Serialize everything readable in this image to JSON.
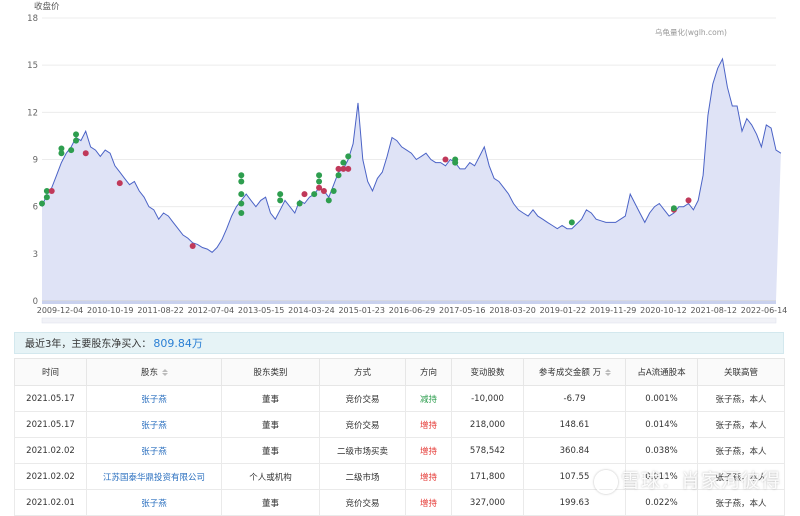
{
  "chart_data": {
    "type": "area",
    "ylabel": "收盘价",
    "watermark": "乌龟量化(wglh.com)",
    "ylim": [
      0,
      18
    ],
    "yticks": [
      0,
      3,
      6,
      9,
      12,
      15,
      18
    ],
    "xtick_labels": [
      "2009-12-04",
      "2010-10-19",
      "2011-08-22",
      "2012-07-04",
      "2013-05-15",
      "2014-03-24",
      "2015-01-23",
      "2016-06-29",
      "2017-05-16",
      "2018-03-20",
      "2019-01-22",
      "2019-11-29",
      "2020-10-12",
      "2021-08-12",
      "2022-06-14"
    ],
    "x": [
      "2009-12",
      "2010-01",
      "2010-02",
      "2010-03",
      "2010-04",
      "2010-05",
      "2010-06",
      "2010-07",
      "2010-08",
      "2010-09",
      "2010-10",
      "2010-11",
      "2010-12",
      "2011-01",
      "2011-02",
      "2011-03",
      "2011-04",
      "2011-05",
      "2011-06",
      "2011-07",
      "2011-08",
      "2011-09",
      "2011-10",
      "2011-11",
      "2011-12",
      "2012-01",
      "2012-02",
      "2012-03",
      "2012-04",
      "2012-05",
      "2012-06",
      "2012-07",
      "2012-08",
      "2012-09",
      "2012-10",
      "2012-11",
      "2012-12",
      "2013-01",
      "2013-02",
      "2013-03",
      "2013-04",
      "2013-05",
      "2013-06",
      "2013-07",
      "2013-08",
      "2013-09",
      "2013-10",
      "2013-11",
      "2013-12",
      "2014-01",
      "2014-02",
      "2014-03",
      "2014-04",
      "2014-05",
      "2014-06",
      "2014-07",
      "2014-08",
      "2014-09",
      "2014-10",
      "2014-11",
      "2014-12",
      "2015-01",
      "2015-02",
      "2015-03",
      "2015-04",
      "2015-05",
      "2015-06",
      "2015-07",
      "2015-08",
      "2015-09",
      "2015-10",
      "2015-11",
      "2015-12",
      "2016-01",
      "2016-02",
      "2016-03",
      "2016-04",
      "2016-05",
      "2016-06",
      "2016-07",
      "2016-08",
      "2016-09",
      "2016-10",
      "2016-11",
      "2016-12",
      "2017-01",
      "2017-02",
      "2017-03",
      "2017-04",
      "2017-05",
      "2017-06",
      "2017-07",
      "2017-08",
      "2017-09",
      "2017-10",
      "2017-11",
      "2017-12",
      "2018-01",
      "2018-02",
      "2018-03",
      "2018-04",
      "2018-05",
      "2018-06",
      "2018-07",
      "2018-08",
      "2018-09",
      "2018-10",
      "2018-11",
      "2018-12",
      "2019-01",
      "2019-02",
      "2019-03",
      "2019-04",
      "2019-05",
      "2019-06",
      "2019-07",
      "2019-08",
      "2019-09",
      "2019-10",
      "2019-11",
      "2019-12",
      "2020-01",
      "2020-02",
      "2020-03",
      "2020-04",
      "2020-05",
      "2020-06",
      "2020-07",
      "2020-08",
      "2020-09",
      "2020-10",
      "2020-11",
      "2020-12",
      "2021-01",
      "2021-02",
      "2021-03",
      "2021-04",
      "2021-05",
      "2021-06",
      "2021-07",
      "2021-08",
      "2021-09",
      "2021-10",
      "2021-11",
      "2021-12",
      "2022-01",
      "2022-02",
      "2022-03",
      "2022-04",
      "2022-05",
      "2022-06",
      "2022-07"
    ],
    "y": [
      6.0,
      6.8,
      7.2,
      8.0,
      8.8,
      9.4,
      9.8,
      10.4,
      10.2,
      10.8,
      9.8,
      9.6,
      9.2,
      9.6,
      9.4,
      8.6,
      8.2,
      7.8,
      7.4,
      7.6,
      7.0,
      6.6,
      6.0,
      5.8,
      5.2,
      5.6,
      5.4,
      5.0,
      4.6,
      4.2,
      4.0,
      3.7,
      3.6,
      3.4,
      3.3,
      3.1,
      3.4,
      3.9,
      4.6,
      5.4,
      6.0,
      6.4,
      6.8,
      6.4,
      6.0,
      6.4,
      6.6,
      5.6,
      5.2,
      5.8,
      6.4,
      6.0,
      5.6,
      6.4,
      6.2,
      6.6,
      6.8,
      7.2,
      7.0,
      6.6,
      7.4,
      8.2,
      8.4,
      9.0,
      10.0,
      12.6,
      9.0,
      7.6,
      7.0,
      7.8,
      8.2,
      9.2,
      10.4,
      10.2,
      9.8,
      9.6,
      9.4,
      9.0,
      9.2,
      9.4,
      9.0,
      8.8,
      8.8,
      8.6,
      9.0,
      8.8,
      8.4,
      8.4,
      8.8,
      8.6,
      9.2,
      9.8,
      8.6,
      7.8,
      7.6,
      7.2,
      6.8,
      6.2,
      5.8,
      5.6,
      5.4,
      5.8,
      5.4,
      5.2,
      5.0,
      4.8,
      4.6,
      4.8,
      4.6,
      4.6,
      4.9,
      5.2,
      5.8,
      5.6,
      5.2,
      5.1,
      5.0,
      5.0,
      5.0,
      5.2,
      5.4,
      6.8,
      6.2,
      5.6,
      5.0,
      5.6,
      6.0,
      6.2,
      5.8,
      5.4,
      5.6,
      6.0,
      6.0,
      6.2,
      5.8,
      6.4,
      8.0,
      11.8,
      13.8,
      14.8,
      15.4,
      13.6,
      12.4,
      12.4,
      10.8,
      11.6,
      11.2,
      10.6,
      9.8,
      11.2,
      11.0,
      9.6,
      9.4
    ],
    "markers": [
      {
        "x": "2009-12",
        "y": 6.2,
        "color": "#2e9e4f"
      },
      {
        "x": "2010-01",
        "y": 6.6,
        "color": "#2e9e4f"
      },
      {
        "x": "2010-01",
        "y": 7.0,
        "color": "#2e9e4f"
      },
      {
        "x": "2010-02",
        "y": 7.0,
        "color": "#c0395a"
      },
      {
        "x": "2010-04",
        "y": 9.4,
        "color": "#2e9e4f"
      },
      {
        "x": "2010-04",
        "y": 9.7,
        "color": "#2e9e4f"
      },
      {
        "x": "2010-06",
        "y": 9.6,
        "color": "#2e9e4f"
      },
      {
        "x": "2010-07",
        "y": 10.2,
        "color": "#2e9e4f"
      },
      {
        "x": "2010-07",
        "y": 10.6,
        "color": "#2e9e4f"
      },
      {
        "x": "2010-09",
        "y": 9.4,
        "color": "#c0395a"
      },
      {
        "x": "2011-04",
        "y": 7.5,
        "color": "#c0395a"
      },
      {
        "x": "2012-07",
        "y": 3.5,
        "color": "#c0395a"
      },
      {
        "x": "2013-05",
        "y": 8.0,
        "color": "#2e9e4f"
      },
      {
        "x": "2013-05",
        "y": 7.6,
        "color": "#2e9e4f"
      },
      {
        "x": "2013-05",
        "y": 6.8,
        "color": "#2e9e4f"
      },
      {
        "x": "2013-05",
        "y": 6.2,
        "color": "#2e9e4f"
      },
      {
        "x": "2013-05",
        "y": 5.6,
        "color": "#2e9e4f"
      },
      {
        "x": "2014-01",
        "y": 6.8,
        "color": "#2e9e4f"
      },
      {
        "x": "2014-01",
        "y": 6.4,
        "color": "#2e9e4f"
      },
      {
        "x": "2014-05",
        "y": 6.2,
        "color": "#2e9e4f"
      },
      {
        "x": "2014-06",
        "y": 6.8,
        "color": "#c0395a"
      },
      {
        "x": "2014-08",
        "y": 6.8,
        "color": "#2e9e4f"
      },
      {
        "x": "2014-09",
        "y": 7.2,
        "color": "#c0395a"
      },
      {
        "x": "2014-09",
        "y": 7.6,
        "color": "#2e9e4f"
      },
      {
        "x": "2014-09",
        "y": 8.0,
        "color": "#2e9e4f"
      },
      {
        "x": "2014-10",
        "y": 7.0,
        "color": "#c0395a"
      },
      {
        "x": "2014-11",
        "y": 6.4,
        "color": "#2e9e4f"
      },
      {
        "x": "2014-12",
        "y": 7.0,
        "color": "#2e9e4f"
      },
      {
        "x": "2015-01",
        "y": 8.0,
        "color": "#2e9e4f"
      },
      {
        "x": "2015-01",
        "y": 8.4,
        "color": "#c0395a"
      },
      {
        "x": "2015-02",
        "y": 8.4,
        "color": "#c0395a"
      },
      {
        "x": "2015-02",
        "y": 8.8,
        "color": "#2e9e4f"
      },
      {
        "x": "2015-03",
        "y": 9.2,
        "color": "#2e9e4f"
      },
      {
        "x": "2015-03",
        "y": 8.4,
        "color": "#c0395a"
      },
      {
        "x": "2016-11",
        "y": 9.0,
        "color": "#c0395a"
      },
      {
        "x": "2017-01",
        "y": 9.0,
        "color": "#2e9e4f"
      },
      {
        "x": "2017-01",
        "y": 8.8,
        "color": "#2e9e4f"
      },
      {
        "x": "2019-01",
        "y": 5.0,
        "color": "#2e9e4f"
      },
      {
        "x": "2020-10",
        "y": 5.8,
        "color": "#c0395a"
      },
      {
        "x": "2020-10",
        "y": 5.9,
        "color": "#2e9e4f"
      },
      {
        "x": "2021-01",
        "y": 6.4,
        "color": "#c0395a"
      }
    ],
    "line_color": "#4b63c6",
    "fill_color": "#dfe3f6",
    "grid": true
  },
  "summary": {
    "label": "最近3年，主要股东净买入：",
    "amount": "809.84万"
  },
  "table": {
    "headers": [
      "时间",
      "股东",
      "股东类别",
      "方式",
      "方向",
      "变动股数",
      "参考成交金额 万",
      "占A流通股本",
      "关联高管"
    ],
    "rows": [
      [
        "2021.05.17",
        "张子燕",
        "董事",
        "竞价交易",
        "减持",
        "-10,000",
        "-6.79",
        "0.001%",
        "张子燕，本人"
      ],
      [
        "2021.05.17",
        "张子燕",
        "董事",
        "竞价交易",
        "增持",
        "218,000",
        "148.61",
        "0.014%",
        "张子燕，本人"
      ],
      [
        "2021.02.02",
        "张子燕",
        "董事",
        "二级市场买卖",
        "增持",
        "578,542",
        "360.84",
        "0.038%",
        "张子燕，本人"
      ],
      [
        "2021.02.02",
        "江苏国泰华鼎投资有限公司",
        "个人或机构",
        "二级市场",
        "增持",
        "171,800",
        "107.55",
        "0.011%",
        "张子燕，本人"
      ],
      [
        "2021.02.01",
        "张子燕",
        "董事",
        "竞价交易",
        "增持",
        "327,000",
        "199.63",
        "0.022%",
        "张子燕，本人"
      ]
    ],
    "direction_colors": {
      "增持": "#e53935",
      "减持": "#2e9e4f"
    }
  },
  "watermark_text": "雪球：肖家河彼得"
}
